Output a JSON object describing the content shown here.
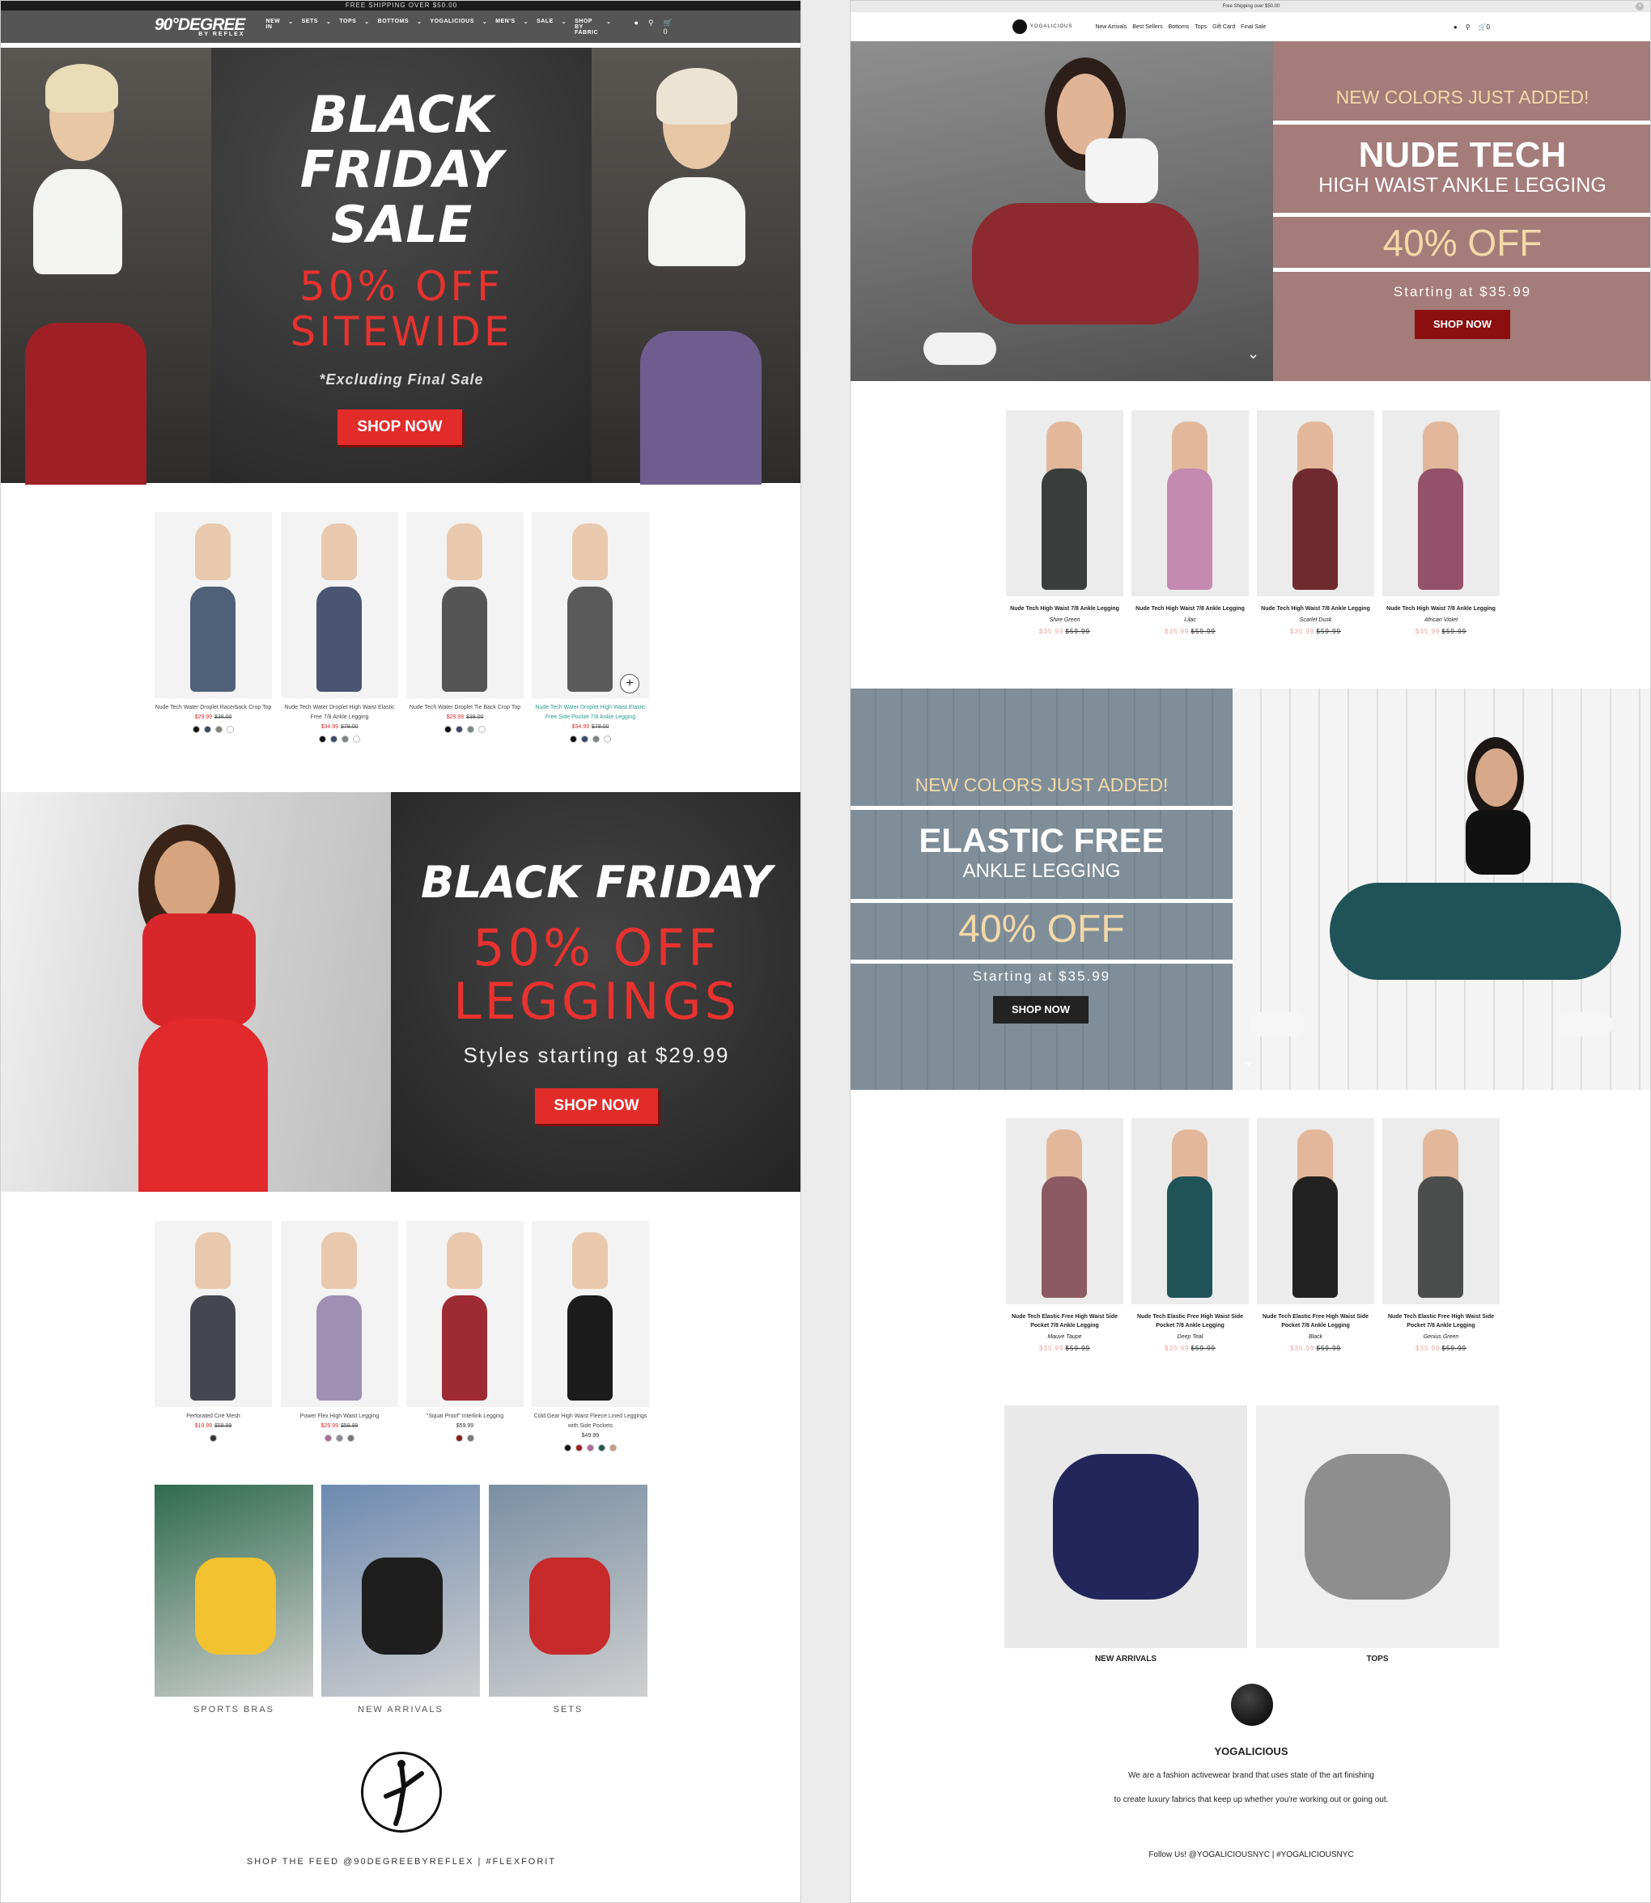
{
  "left": {
    "shipping_bar": "FREE SHIPPING OVER $50.00",
    "logo": {
      "main": "90°DEGREE",
      "sub": "BY REFLEX"
    },
    "nav": [
      "NEW IN",
      "SETS",
      "TOPS",
      "BOTTOMS",
      "YOGALICIOUS",
      "MEN'S",
      "SALE",
      "SHOP BY FABRIC"
    ],
    "cart_count": "0",
    "hero1": {
      "line1": "BLACK",
      "line2": "FRIDAY",
      "line3": "SALE",
      "offer1": "50% OFF",
      "offer2": "SITEWIDE",
      "note": "*Excluding Final Sale",
      "button": "SHOP NOW"
    },
    "products1": [
      {
        "name": "Nude Tech Water Droplet Racerback Crop Top",
        "price": "$29.99",
        "was": "$38.00",
        "swatches": [
          "#111111",
          "#3b4a6b",
          "#7d8583",
          "#ffffff"
        ]
      },
      {
        "name": "Nude Tech Water Droplet High Waist Elastic Free 7/8 Ankle Legging",
        "price": "$34.99",
        "was": "$78.00",
        "swatches": [
          "#111111",
          "#3b4a6b",
          "#7d8583",
          "#ffffff"
        ]
      },
      {
        "name": "Nude Tech Water Droplet Tie Back Crop Top",
        "price": "$29.99",
        "was": "$38.00",
        "swatches": [
          "#111111",
          "#3b4a6b",
          "#7d8583",
          "#ffffff"
        ]
      },
      {
        "name": "Nude Tech Water Droplet High Waist Elastic Free Side Pocket 7/8 Ankle Legging",
        "price": "$34.99",
        "was": "$78.00",
        "swatches": [
          "#111111",
          "#3b4a6b",
          "#7d8583",
          "#ffffff"
        ]
      }
    ],
    "hero2": {
      "title": "BLACK FRIDAY",
      "offer1": "50% OFF",
      "offer2": "LEGGINGS",
      "sub": "Styles starting at $29.99",
      "button": "SHOP NOW"
    },
    "products2": [
      {
        "name": "Perforated Ciré Mesh",
        "price": "$19.99",
        "was": "$59.99",
        "swatches": [
          "#333333"
        ]
      },
      {
        "name": "Power Flex High Waist Legging",
        "price": "$29.99",
        "was": "$59.99",
        "swatches": [
          "#b06a9a",
          "#8b8b9a",
          "#777777"
        ]
      },
      {
        "name": "\"Squat Proof\" Interlink Legging",
        "price": "$59.99",
        "was": "",
        "swatches": [
          "#8a1d1d",
          "#777777"
        ]
      },
      {
        "name": "Cold Gear High Waist Fleece Lined Leggings with Side Pockets",
        "price": "$49.99",
        "was": "",
        "swatches": [
          "#111111",
          "#a01c1c",
          "#b06a9a",
          "#1f5a4f",
          "#c99a8a"
        ]
      }
    ],
    "categories": [
      "SPORTS BRAS",
      "NEW ARRIVALS",
      "SETS"
    ],
    "footer": "SHOP THE FEED @90DEGREEBYREFLEX | #FLEXFORIT"
  },
  "right": {
    "shipping_bar": "Free Shipping over $50.00",
    "logo": "YOGALICIOUS",
    "nav": [
      "New Arrivals",
      "Best Sellers",
      "Bottoms",
      "Tops",
      "Gift Card",
      "Final Sale"
    ],
    "cart_count": "0",
    "hero1": {
      "kicker": "NEW COLORS JUST ADDED!",
      "title": "NUDE TECH",
      "subtitle": "HIGH WAIST ANKLE LEGGING",
      "offer": "40% OFF",
      "starting": "Starting at $35.99",
      "button": "SHOP NOW"
    },
    "products1": [
      {
        "name": "Nude Tech High Waist 7/8 Ankle Legging",
        "color": "Shire Green",
        "price": "$35.99",
        "was": "$59.99",
        "fill": "#3a3d3c"
      },
      {
        "name": "Nude Tech High Waist 7/8 Ankle Legging",
        "color": "Lilac",
        "price": "$35.99",
        "was": "$59.99",
        "fill": "#c48ab0"
      },
      {
        "name": "Nude Tech High Waist 7/8 Ankle Legging",
        "color": "Scarlet Dusk",
        "price": "$35.99",
        "was": "$59.99",
        "fill": "#6e2a2f"
      },
      {
        "name": "Nude Tech High Waist 7/8 Ankle Legging",
        "color": "African Violet",
        "price": "$35.99",
        "was": "$59.99",
        "fill": "#94516a"
      }
    ],
    "hero2": {
      "kicker": "NEW COLORS JUST ADDED!",
      "title": "ELASTIC FREE",
      "subtitle": "ANKLE LEGGING",
      "offer": "40% OFF",
      "starting": "Starting at $35.99",
      "button": "SHOP NOW"
    },
    "products2": [
      {
        "name": "Nude Tech Elastic Free High Waist Side Pocket 7/8 Ankle Legging",
        "color": "Mauve Taupe",
        "price": "$35.99",
        "was": "$59.99",
        "fill": "#8c5a63"
      },
      {
        "name": "Nude Tech Elastic Free High Waist Side Pocket 7/8 Ankle Legging",
        "color": "Deep Teal",
        "price": "$35.99",
        "was": "$59.99",
        "fill": "#1f5358"
      },
      {
        "name": "Nude Tech Elastic Free High Waist Side Pocket 7/8 Ankle Legging",
        "color": "Black",
        "price": "$35.99",
        "was": "$59.99",
        "fill": "#222222"
      },
      {
        "name": "Nude Tech Elastic Free High Waist Side Pocket 7/8 Ankle Legging",
        "color": "Genius Green",
        "price": "$35.99",
        "was": "$59.99",
        "fill": "#4a4d4c"
      }
    ],
    "categories": [
      "NEW ARRIVALS",
      "TOPS"
    ],
    "brand": "YOGALICIOUS",
    "about1": "We are a fashion activewear brand that uses state of the art finishing",
    "about2": "to create luxury fabrics that keep up whether you're working out or going out.",
    "follow": "Follow Us! @YOGALICIOUSNYC | #YOGALICIOUSNYC"
  }
}
